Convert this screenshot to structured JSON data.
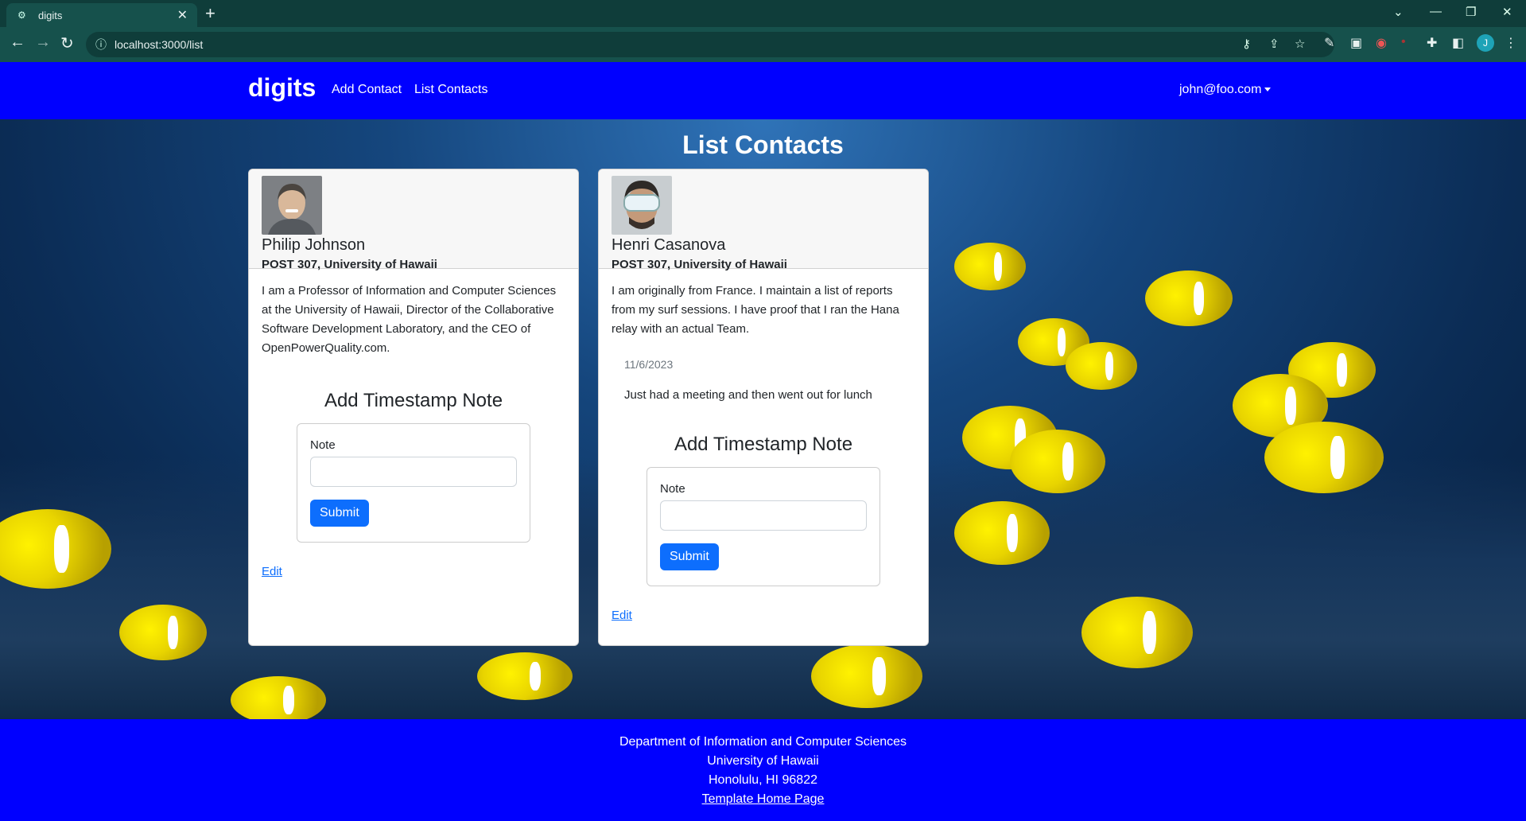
{
  "browser": {
    "tab_title": "digits",
    "url": "localhost:3000/list",
    "avatar_letter": "J"
  },
  "navbar": {
    "brand": "digits",
    "links": [
      "Add Contact",
      "List Contacts"
    ],
    "user": "john@foo.com"
  },
  "page": {
    "title": "List Contacts"
  },
  "contacts": [
    {
      "name": "Philip Johnson",
      "address": "POST 307, University of Hawaii",
      "description": "I am a Professor of Information and Computer Sciences at the University of Hawaii, Director of the Collaborative Software Development Laboratory, and the CEO of OpenPowerQuality.com.",
      "notes": [],
      "form_title": "Add Timestamp Note",
      "note_label": "Note",
      "submit_label": "Submit",
      "edit_label": "Edit"
    },
    {
      "name": "Henri Casanova",
      "address": "POST 307, University of Hawaii",
      "description": "I am originally from France. I maintain a list of reports from my surf sessions. I have proof that I ran the Hana relay with an actual Team.",
      "notes": [
        {
          "date": "11/6/2023",
          "text": "Just had a meeting and then went out for lunch"
        }
      ],
      "form_title": "Add Timestamp Note",
      "note_label": "Note",
      "submit_label": "Submit",
      "edit_label": "Edit"
    }
  ],
  "footer": {
    "lines": [
      "Department of Information and Computer Sciences",
      "University of Hawaii",
      "Honolulu, HI 96822"
    ],
    "link": "Template Home Page"
  }
}
